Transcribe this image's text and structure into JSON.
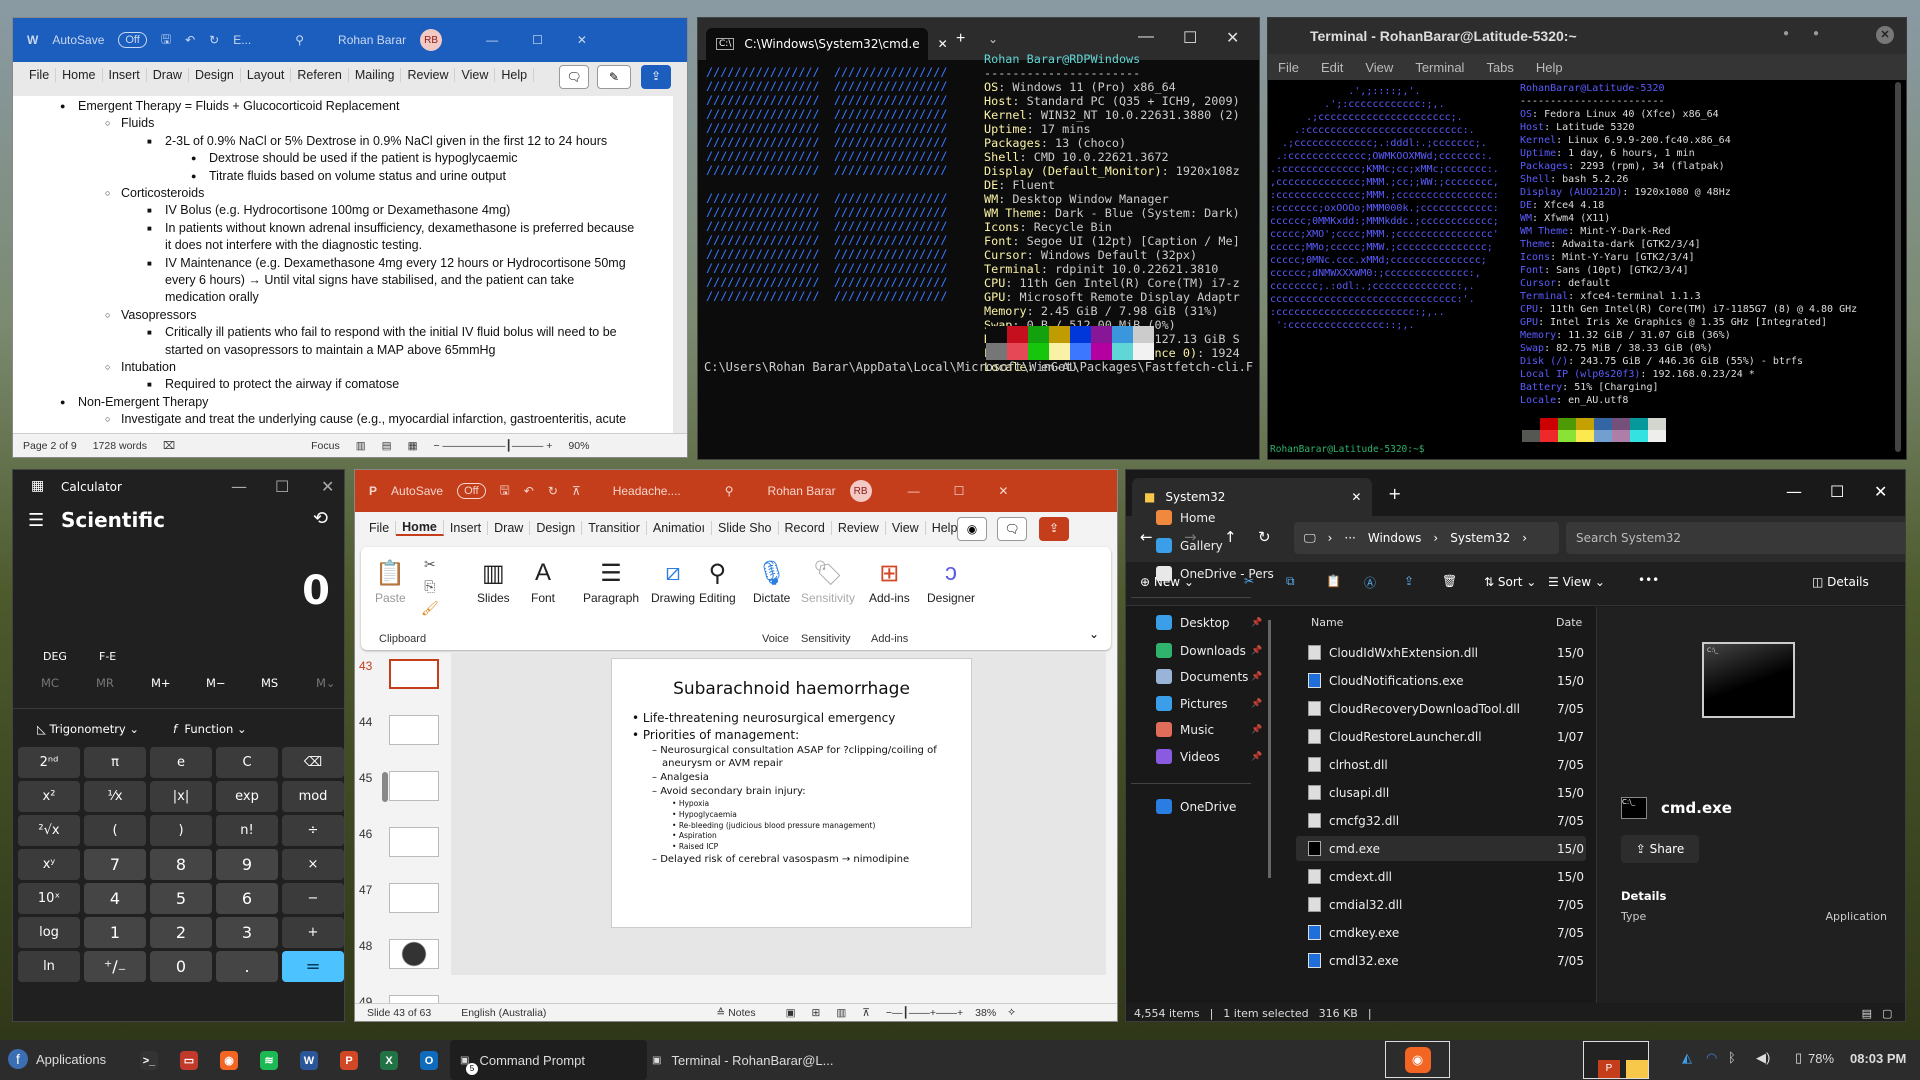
{
  "word": {
    "autosave_label": "AutoSave",
    "autosave_state": "Off",
    "doc_name": "E...",
    "user_name": "Rohan Barar",
    "user_initials": "RB",
    "accent": "#1b5ebe",
    "tabs": [
      "File",
      "Home",
      "Insert",
      "Draw",
      "Design",
      "Layout",
      "Referen",
      "Mailing",
      "Review",
      "View",
      "Help"
    ],
    "body_lines": [
      {
        "level": 1,
        "bullet": "●",
        "text": "Emergent Therapy = Fluids + Glucocorticoid Replacement"
      },
      {
        "level": 2,
        "bullet": "○",
        "text": "Fluids"
      },
      {
        "level": 3,
        "bullet": "■",
        "text": "2-3L of 0.9% NaCl or 5% Dextrose in 0.9% NaCl given in the first 12 to 24 hours"
      },
      {
        "level": 4,
        "bullet": "●",
        "text": "Dextrose should be used if the patient is hypoglycaemic"
      },
      {
        "level": 4,
        "bullet": "●",
        "text": "Titrate fluids based on volume status and urine output"
      },
      {
        "level": 2,
        "bullet": "○",
        "text": "Corticosteroids"
      },
      {
        "level": 3,
        "bullet": "■",
        "text": "IV Bolus (e.g. Hydrocortisone 100mg or Dexamethasone 4mg)"
      },
      {
        "level": 3,
        "bullet": "■",
        "text": "In patients without known adrenal insufficiency, dexamethasone is preferred because"
      },
      {
        "level": 3,
        "bullet": "",
        "text": "it does not interfere with the diagnostic testing."
      },
      {
        "level": 3,
        "bullet": "■",
        "text": "IV Maintenance (e.g. Dexamethasone 4mg every 12 hours or Hydrocortisone 50mg"
      },
      {
        "level": 3,
        "bullet": "",
        "text": "every 6 hours) → Until vital signs have stabilised, and the patient can take"
      },
      {
        "level": 3,
        "bullet": "",
        "text": "medication orally"
      },
      {
        "level": 2,
        "bullet": "○",
        "text": "Vasopressors"
      },
      {
        "level": 3,
        "bullet": "■",
        "text": "Critically ill patients who fail to respond with the initial IV fluid bolus will need to be"
      },
      {
        "level": 3,
        "bullet": "",
        "text": "started on vasopressors to maintain a MAP above 65mmHg"
      },
      {
        "level": 2,
        "bullet": "○",
        "text": "Intubation"
      },
      {
        "level": 3,
        "bullet": "■",
        "text": "Required to protect the airway if comatose"
      },
      {
        "level": 1,
        "bullet": "●",
        "text": "Non-Emergent Therapy"
      },
      {
        "level": 2,
        "bullet": "○",
        "text": "Investigate and treat the underlying cause (e.g., myocardial infarction, gastroenteritis, acute"
      }
    ],
    "status": {
      "page": "Page 2 of 9",
      "words": "1728 words",
      "focus": "Focus",
      "zoom": "90%"
    }
  },
  "cmd": {
    "tab_title": "C:\\Windows\\System32\\cmd.e",
    "logo_line": "////////////////  ////////////////",
    "user_host": "Rohan Barar@RDPWindows",
    "separator": "----------------------",
    "key_color": "#f9f1a5",
    "info": [
      [
        "OS",
        ": Windows 11 (Pro) x86_64"
      ],
      [
        "Host",
        ": Standard PC (Q35 + ICH9, 2009)"
      ],
      [
        "Kernel",
        ": WIN32_NT 10.0.22631.3880 (2)"
      ],
      [
        "Uptime",
        ": 17 mins"
      ],
      [
        "Packages",
        ": 13 (choco)"
      ],
      [
        "Shell",
        ": CMD 10.0.22621.3672"
      ],
      [
        "Display (Default_Monitor)",
        ": 1920x108z"
      ],
      [
        "DE",
        ": Fluent"
      ],
      [
        "WM",
        ": Desktop Window Manager"
      ],
      [
        "WM Theme",
        ": Dark - Blue (System: Dark)"
      ],
      [
        "Icons",
        ": Recycle Bin"
      ],
      [
        "Font",
        ": Segoe UI (12pt) [Caption / Me]"
      ],
      [
        "Cursor",
        ": Windows Default (32px)"
      ],
      [
        "Terminal",
        ": rdpinit 10.0.22621.3810"
      ],
      [
        "CPU",
        ": 11th Gen Intel(R) Core(TM) i7-z"
      ],
      [
        "GPU",
        ": Microsoft Remote Display Adaptr"
      ],
      [
        "Memory",
        ": 2.45 GiB / 7.98 GiB (31%)"
      ],
      [
        "Swap",
        ": 0 B / 512.00 MiB (0%)"
      ],
      [
        "Disk (C:\\)",
        ": 31.15 GiB / 127.13 GiB S"
      ],
      [
        "Local IP (Ethernet Instance 0)",
        ": 1924"
      ],
      [
        "Locale",
        ": en-AU"
      ]
    ],
    "palette_top": [
      "#0c0c0c",
      "#c50f1f",
      "#13a10e",
      "#c19c00",
      "#0037da",
      "#881798",
      "#3a96dd",
      "#cccccc"
    ],
    "palette_bottom": [
      "#767676",
      "#e74856",
      "#16c60c",
      "#f9f1a5",
      "#3b78ff",
      "#b4009e",
      "#61d6d6",
      "#f2f2f2"
    ],
    "prompt": "C:\\Users\\Rohan Barar\\AppData\\Local\\Microsoft\\WinGet\\Packages\\Fastfetch-cli.F"
  },
  "xfce_terminal": {
    "title": "Terminal - RohanBarar@Latitude-5320:~",
    "menu": [
      "File",
      "Edit",
      "View",
      "Terminal",
      "Tabs",
      "Help"
    ],
    "logo": [
      "             .',;::::;,'.",
      "         .';:cccccccccccc:;,.",
      "      .;cccccccccccccccccccccc;.",
      "    .:cccccccccccccccccccccccccc:.",
      "  .;ccccccccccccc;.:dddl:.;ccccccc;.",
      " .:ccccccccccccc;OWMKOOXMWd;ccccccc:.",
      ".:ccccccccccccc;KMMc;cc;xMMc;ccccccc:.",
      ",cccccccccccccc;MMM.;cc;;WW:;cccccccc,",
      ":cccccccccccccc;MMM.;cccccccccccccccc:",
      ":ccccccc;oxOOOo;MMM000k.;cccccccccccc:",
      "cccccc;0MMKxdd:;MMMkddc.;cccccccccccc;",
      "ccccc;XMO';cccc;MMM.;cccccccccccccccc'",
      "ccccc;MMo;ccccc;MMW.;ccccccccccccccc;",
      "ccccc;0MNc.ccc.xMMd;ccccccccccccccc;",
      "cccccc;dNMWXXXWM0:;cccccccccccccc:,",
      "cccccccc;.:odl:.;cccccccccccccc:,.",
      "ccccccccccccccccccccccccccccccc:'.",
      ":ccccccccccccccccccccccc:;,..",
      " ':cccccccccccccccc::;,."
    ],
    "user_host": "RohanBarar@Latitude-5320",
    "separator": "------------------------",
    "key_color": "#5c5cff",
    "info": [
      [
        "OS",
        ": Fedora Linux 40 (Xfce) x86_64"
      ],
      [
        "Host",
        ": Latitude 5320"
      ],
      [
        "Kernel",
        ": Linux 6.9.9-200.fc40.x86_64"
      ],
      [
        "Uptime",
        ": 1 day, 6 hours, 1 min"
      ],
      [
        "Packages",
        ": 2293 (rpm), 34 (flatpak)"
      ],
      [
        "Shell",
        ": bash 5.2.26"
      ],
      [
        "Display (AUO212D)",
        ": 1920x1080 @ 48Hz"
      ],
      [
        "DE",
        ": Xfce4 4.18"
      ],
      [
        "WM",
        ": Xfwm4 (X11)"
      ],
      [
        "WM Theme",
        ": Mint-Y-Dark-Red"
      ],
      [
        "Theme",
        ": Adwaita-dark [GTK2/3/4]"
      ],
      [
        "Icons",
        ": Mint-Y-Yaru [GTK2/3/4]"
      ],
      [
        "Font",
        ": Sans (10pt) [GTK2/3/4]"
      ],
      [
        "Cursor",
        ": default"
      ],
      [
        "Terminal",
        ": xfce4-terminal 1.1.3"
      ],
      [
        "CPU",
        ": 11th Gen Intel(R) Core(TM) i7-1185G7 (8) @ 4.80 GHz"
      ],
      [
        "GPU",
        ": Intel Iris Xe Graphics @ 1.35 GHz [Integrated]"
      ],
      [
        "Memory",
        ": 11.32 GiB / 31.07 GiB (36%)"
      ],
      [
        "Swap",
        ": 82.75 MiB / 38.33 GiB (0%)"
      ],
      [
        "Disk (/)",
        ": 243.75 GiB / 446.36 GiB (55%) - btrfs"
      ],
      [
        "Local IP (wlp0s20f3)",
        ": 192.168.0.23/24 *"
      ],
      [
        "Battery",
        ": 51% [Charging]"
      ],
      [
        "Locale",
        ": en_AU.utf8"
      ]
    ],
    "palette_top": [
      "#000000",
      "#cc0000",
      "#4e9a06",
      "#c4a000",
      "#3465a4",
      "#75507b",
      "#06989a",
      "#d3d7cf"
    ],
    "palette_bottom": [
      "#555753",
      "#ef2929",
      "#8ae234",
      "#fce94f",
      "#729fcf",
      "#ad7fa8",
      "#34e2e2",
      "#eeeeec"
    ],
    "prompt": "RohanBarar@Latitude-5320:~$ "
  },
  "calculator": {
    "title": "Calculator",
    "mode": "Scientific",
    "display": "0",
    "angle": "DEG",
    "fe": "F-E",
    "memory": [
      "MC",
      "MR",
      "M+",
      "M−",
      "MS",
      "M⌄"
    ],
    "trig_label": "Trigonometry",
    "function_label": "Function",
    "keys": [
      [
        "2ⁿᵈ",
        "π",
        "e",
        "C",
        "⌫"
      ],
      [
        "x²",
        "¹⁄x",
        "|x|",
        "exp",
        "mod"
      ],
      [
        "²√x",
        "(",
        ")",
        "n!",
        "÷"
      ],
      [
        "xʸ",
        "7",
        "8",
        "9",
        "×"
      ],
      [
        "10ˣ",
        "4",
        "5",
        "6",
        "−"
      ],
      [
        "log",
        "1",
        "2",
        "3",
        "+"
      ],
      [
        "ln",
        "⁺∕₋",
        "0",
        ".",
        "="
      ]
    ],
    "accent": "#4cc2ff"
  },
  "powerpoint": {
    "autosave_label": "AutoSave",
    "autosave_state": "Off",
    "doc_name": "Headache....",
    "user_name": "Rohan Barar",
    "user_initials": "RB",
    "accent": "#c43e1c",
    "tabs": [
      "File",
      "Home",
      "Insert",
      "Draw",
      "Design",
      "Transitior",
      "Animatioı",
      "Slide Sho",
      "Record",
      "Review",
      "View",
      "Help"
    ],
    "ribbon": {
      "paste": "Paste",
      "slides": "Slides",
      "font": "Font",
      "paragraph": "Paragraph",
      "drawing": "Drawing",
      "editing": "Editing",
      "dictate": "Dictate",
      "sensitivity": "Sensitivity",
      "addins": "Add-ins",
      "designer": "Designer",
      "groups": {
        "clipboard": "Clipboard",
        "voice": "Voice",
        "sensitivity": "Sensitivity",
        "addins": "Add-ins"
      }
    },
    "thumbnails": [
      "43",
      "44",
      "45",
      "46",
      "47",
      "48",
      "49"
    ],
    "slide": {
      "title": "Subarachnoid haemorrhage",
      "bullets": [
        {
          "level": 1,
          "text": "Life-threatening neurosurgical emergency"
        },
        {
          "level": 1,
          "text": "Priorities of management:"
        },
        {
          "level": 2,
          "text": "Neurosurgical consultation ASAP for ?clipping/coiling of aneurysm or AVM repair"
        },
        {
          "level": 2,
          "text": "Analgesia"
        },
        {
          "level": 2,
          "text": "Avoid secondary brain injury:"
        },
        {
          "level": 3,
          "text": "Hypoxia"
        },
        {
          "level": 3,
          "text": "Hypoglycaemia"
        },
        {
          "level": 3,
          "text": "Re-bleeding (judicious blood pressure management)"
        },
        {
          "level": 3,
          "text": "Aspiration"
        },
        {
          "level": 3,
          "text": "Raised ICP"
        },
        {
          "level": 2,
          "text": "Delayed risk of cerebral vasospasm → nimodipine"
        }
      ]
    },
    "status": {
      "slide": "Slide 43 of 63",
      "language": "English (Australia)",
      "notes": "Notes",
      "zoom": "38%"
    }
  },
  "explorer": {
    "tab_title": "System32",
    "breadcrumb": [
      "Windows",
      "System32"
    ],
    "search_placeholder": "Search System32",
    "toolbar": {
      "new": "New",
      "sort": "Sort",
      "view": "View",
      "details": "Details"
    },
    "nav": [
      {
        "label": "Home",
        "color": "#f0883e"
      },
      {
        "label": "Gallery",
        "color": "#3a9ee8"
      },
      {
        "label": "OneDrive - Pers",
        "color": "#e8e8e8"
      },
      {
        "label": "Desktop",
        "color": "#3a9ee8"
      },
      {
        "label": "Downloads",
        "color": "#2fb36d"
      },
      {
        "label": "Documents",
        "color": "#9ab4d8"
      },
      {
        "label": "Pictures",
        "color": "#3a9ee8"
      },
      {
        "label": "Music",
        "color": "#e06c5a"
      },
      {
        "label": "Videos",
        "color": "#8a5ae0"
      },
      {
        "label": "OneDrive",
        "color": "#2a7de1"
      }
    ],
    "columns": {
      "name": "Name",
      "date": "Date"
    },
    "files": [
      {
        "name": "CloudIdWxhExtension.dll",
        "date": "15/0"
      },
      {
        "name": "CloudNotifications.exe",
        "date": "15/0"
      },
      {
        "name": "CloudRecoveryDownloadTool.dll",
        "date": "7/05"
      },
      {
        "name": "CloudRestoreLauncher.dll",
        "date": "1/07"
      },
      {
        "name": "clrhost.dll",
        "date": "7/05"
      },
      {
        "name": "clusapi.dll",
        "date": "15/0"
      },
      {
        "name": "cmcfg32.dll",
        "date": "7/05"
      },
      {
        "name": "cmd.exe",
        "date": "15/0",
        "selected": true
      },
      {
        "name": "cmdext.dll",
        "date": "15/0"
      },
      {
        "name": "cmdial32.dll",
        "date": "7/05"
      },
      {
        "name": "cmdkey.exe",
        "date": "7/05"
      },
      {
        "name": "cmdl32.exe",
        "date": "7/05"
      }
    ],
    "details_pane": {
      "name": "cmd.exe",
      "share": "Share",
      "section": "Details",
      "type_label": "Type",
      "type_value": "Application"
    },
    "status": {
      "items": "4,554 items",
      "selected": "1 item selected",
      "size": "316 KB"
    }
  },
  "taskbar": {
    "applications": "Applications",
    "apps": [
      {
        "name": "terminal",
        "color": "#333",
        "glyph": ">_"
      },
      {
        "name": "files",
        "color": "#c0392b",
        "glyph": "▭"
      },
      {
        "name": "firefox",
        "color": "#f26522",
        "glyph": "◉"
      },
      {
        "name": "spotify",
        "color": "#1db954",
        "glyph": "≋"
      },
      {
        "name": "word",
        "color": "#2b579a",
        "glyph": "W"
      },
      {
        "name": "powerpoint",
        "color": "#d24726",
        "glyph": "P"
      },
      {
        "name": "excel",
        "color": "#217346",
        "glyph": "X"
      },
      {
        "name": "outlook",
        "color": "#0f6cbd",
        "glyph": "O"
      }
    ],
    "windows": [
      {
        "label": "Command Prompt",
        "badge": "5"
      },
      {
        "label": "Terminal - RohanBarar@L..."
      }
    ],
    "battery": "78%",
    "clock": "08:03 PM"
  }
}
